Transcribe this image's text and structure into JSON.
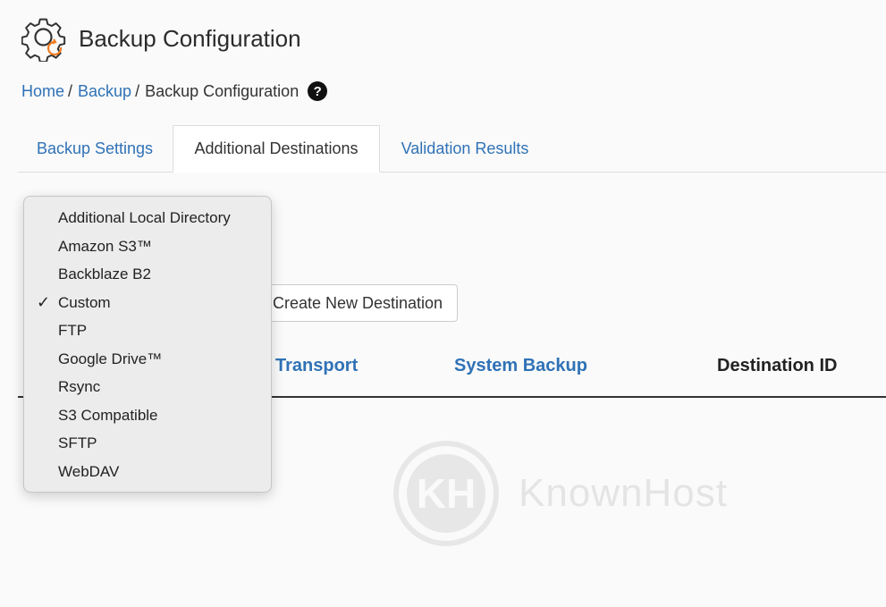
{
  "header": {
    "title": "Backup Configuration",
    "icon": "backup-gear-icon"
  },
  "breadcrumb": {
    "home": "Home",
    "backup": "Backup",
    "current": "Backup Configuration",
    "separator": "/",
    "help_glyph": "?"
  },
  "tabs": [
    {
      "label": "Backup Settings",
      "active": false
    },
    {
      "label": "Additional Destinations",
      "active": true
    },
    {
      "label": "Validation Results",
      "active": false
    }
  ],
  "create_button": {
    "label": "Create New Destination"
  },
  "table": {
    "headers": [
      "Transport",
      "System Backup",
      "Destination ID"
    ]
  },
  "dropdown": {
    "selected": "Custom",
    "check_glyph": "✓",
    "options": [
      "Additional Local Directory",
      "Amazon S3™",
      "Backblaze B2",
      "Custom",
      "FTP",
      "Google Drive™",
      "Rsync",
      "S3 Compatible",
      "SFTP",
      "WebDAV"
    ]
  },
  "watermark": {
    "text": "KnownHost",
    "mark": "KH"
  },
  "colors": {
    "link": "#2f72b6",
    "accent": "#f07c21"
  }
}
